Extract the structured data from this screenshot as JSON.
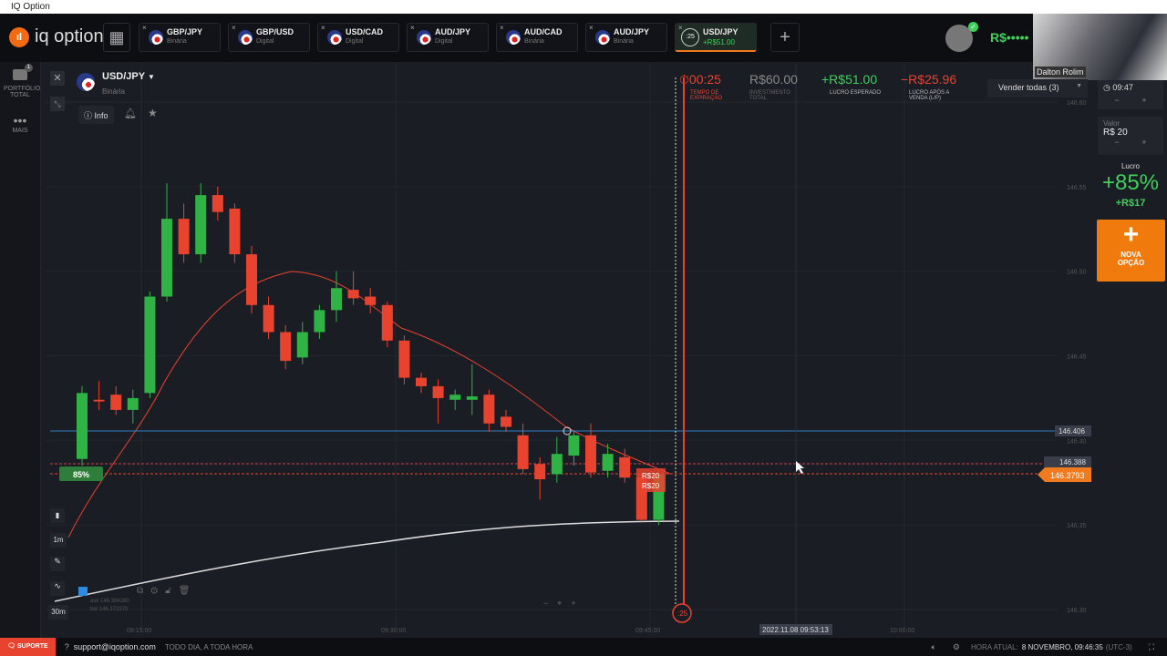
{
  "window": {
    "title": "IQ Option"
  },
  "brand": {
    "logo_text": "iq option"
  },
  "tabs": [
    {
      "pair": "GBP/JPY",
      "type": "Binária"
    },
    {
      "pair": "GBP/USD",
      "type": "Digital"
    },
    {
      "pair": "USD/CAD",
      "type": "Digital"
    },
    {
      "pair": "AUD/JPY",
      "type": "Digital"
    },
    {
      "pair": "AUD/CAD",
      "type": "Binária"
    },
    {
      "pair": "AUD/JPY",
      "type": "Binária"
    },
    {
      "pair": "USD/JPY",
      "type": "+R$51.00",
      "timer": ":25",
      "active": true
    }
  ],
  "account": {
    "balance": "R$•••••"
  },
  "webcam": {
    "name": "Dalton Rolim"
  },
  "sidebar": {
    "portfolio_label": "PORTFÓLIO TOTAL",
    "portfolio_badge": "1",
    "more_label": "MAIS"
  },
  "asset": {
    "pair": "USD/JPY",
    "type": "Binária",
    "info_label": "Info"
  },
  "position": {
    "expiry": "00:25",
    "expiry_label": "TEMPO DE EXPIRAÇÃO",
    "investment": "R$60.00",
    "investment_label": "INVESTIMENTO TOTAL",
    "expected_profit": "+R$51.00",
    "expected_profit_label": "LUCRO ESPERADO",
    "sell_profit": "−R$25.96",
    "sell_profit_label": "LUCRO APÓS A VENDA (L/P)",
    "sell_all": "Vender todas (3)"
  },
  "trade_panel": {
    "time": "09:47",
    "value_label": "Valor",
    "value": "R$ 20",
    "profit_label": "Lucro",
    "profit_pct": "+85%",
    "profit_amount": "+R$17",
    "new_option": "NOVA OPÇÃO",
    "minus": "−",
    "plus": "+"
  },
  "chart_tools": {
    "timeframe_1m": "1m",
    "timeframe_30m": "30m",
    "payout_badge": "85%",
    "ask": "ask 146.384280",
    "bid": "bid 146.372370",
    "trade_label_1": "R$20",
    "trade_label_2": "R$20",
    "expiry_marker": ":25",
    "crosshair_time": "2022.11.08 09:53:13"
  },
  "price_labels": {
    "line_blue": "146.406",
    "line_grey": "146.388",
    "current": "146.3793"
  },
  "chart_data": {
    "type": "candlestick",
    "ylim": [
      146.3,
      146.6
    ],
    "y_ticks": [
      "146.60",
      "146.55",
      "146.50",
      "146.45",
      "146.40",
      "146.35",
      "146.30"
    ],
    "x_ticks": [
      "09:15:00",
      "09:30:00",
      "09:45:00",
      "10:00:00"
    ],
    "candles": [
      [
        146.389,
        146.432,
        146.385,
        146.428
      ],
      [
        146.424,
        146.435,
        146.418,
        146.423
      ],
      [
        146.427,
        146.432,
        146.415,
        146.418
      ],
      [
        146.418,
        146.43,
        146.41,
        146.425
      ],
      [
        146.428,
        146.488,
        146.425,
        146.485
      ],
      [
        146.485,
        146.552,
        146.482,
        146.531
      ],
      [
        146.531,
        146.54,
        146.505,
        146.51
      ],
      [
        146.51,
        146.552,
        146.505,
        146.545
      ],
      [
        146.545,
        146.55,
        146.53,
        146.535
      ],
      [
        146.537,
        146.54,
        146.505,
        146.51
      ],
      [
        146.51,
        146.515,
        146.475,
        146.48
      ],
      [
        146.48,
        146.485,
        146.46,
        146.464
      ],
      [
        146.464,
        146.468,
        146.442,
        146.447
      ],
      [
        146.449,
        146.47,
        146.445,
        146.464
      ],
      [
        146.464,
        146.48,
        146.46,
        146.477
      ],
      [
        146.477,
        146.5,
        146.47,
        146.49
      ],
      [
        146.489,
        146.5,
        146.48,
        146.484
      ],
      [
        146.485,
        146.49,
        146.475,
        146.48
      ],
      [
        146.48,
        146.482,
        146.455,
        146.459
      ],
      [
        146.459,
        146.462,
        146.433,
        146.437
      ],
      [
        146.437,
        146.44,
        146.428,
        146.432
      ],
      [
        146.432,
        146.436,
        146.41,
        146.425
      ],
      [
        146.424,
        146.43,
        146.418,
        146.427
      ],
      [
        146.424,
        146.445,
        146.415,
        146.426
      ],
      [
        146.427,
        146.43,
        146.405,
        146.41
      ],
      [
        146.414,
        146.418,
        146.405,
        146.408
      ],
      [
        146.403,
        146.41,
        146.38,
        146.383
      ],
      [
        146.386,
        146.39,
        146.365,
        146.377
      ],
      [
        146.38,
        146.402,
        146.375,
        146.392
      ],
      [
        146.391,
        146.406,
        146.385,
        146.403
      ],
      [
        146.403,
        146.41,
        146.378,
        146.381
      ],
      [
        146.382,
        146.398,
        146.378,
        146.392
      ],
      [
        146.39,
        146.395,
        146.375,
        146.378
      ],
      [
        146.378,
        146.38,
        146.352,
        146.353
      ],
      [
        146.353,
        146.382,
        146.35,
        146.38
      ]
    ],
    "candle_fields": [
      "open",
      "high",
      "low",
      "close"
    ],
    "up_color": "#2fb344",
    "down_color": "#e8432f"
  },
  "footer": {
    "support": "SUPORTE",
    "email": "support@iqoption.com",
    "hours": "TODO DIA, A TODA HORA",
    "clock_label": "HORA ATUAL:",
    "clock": "8 NOVEMBRO, 09:46:35",
    "tz": "(UTC-3)"
  }
}
